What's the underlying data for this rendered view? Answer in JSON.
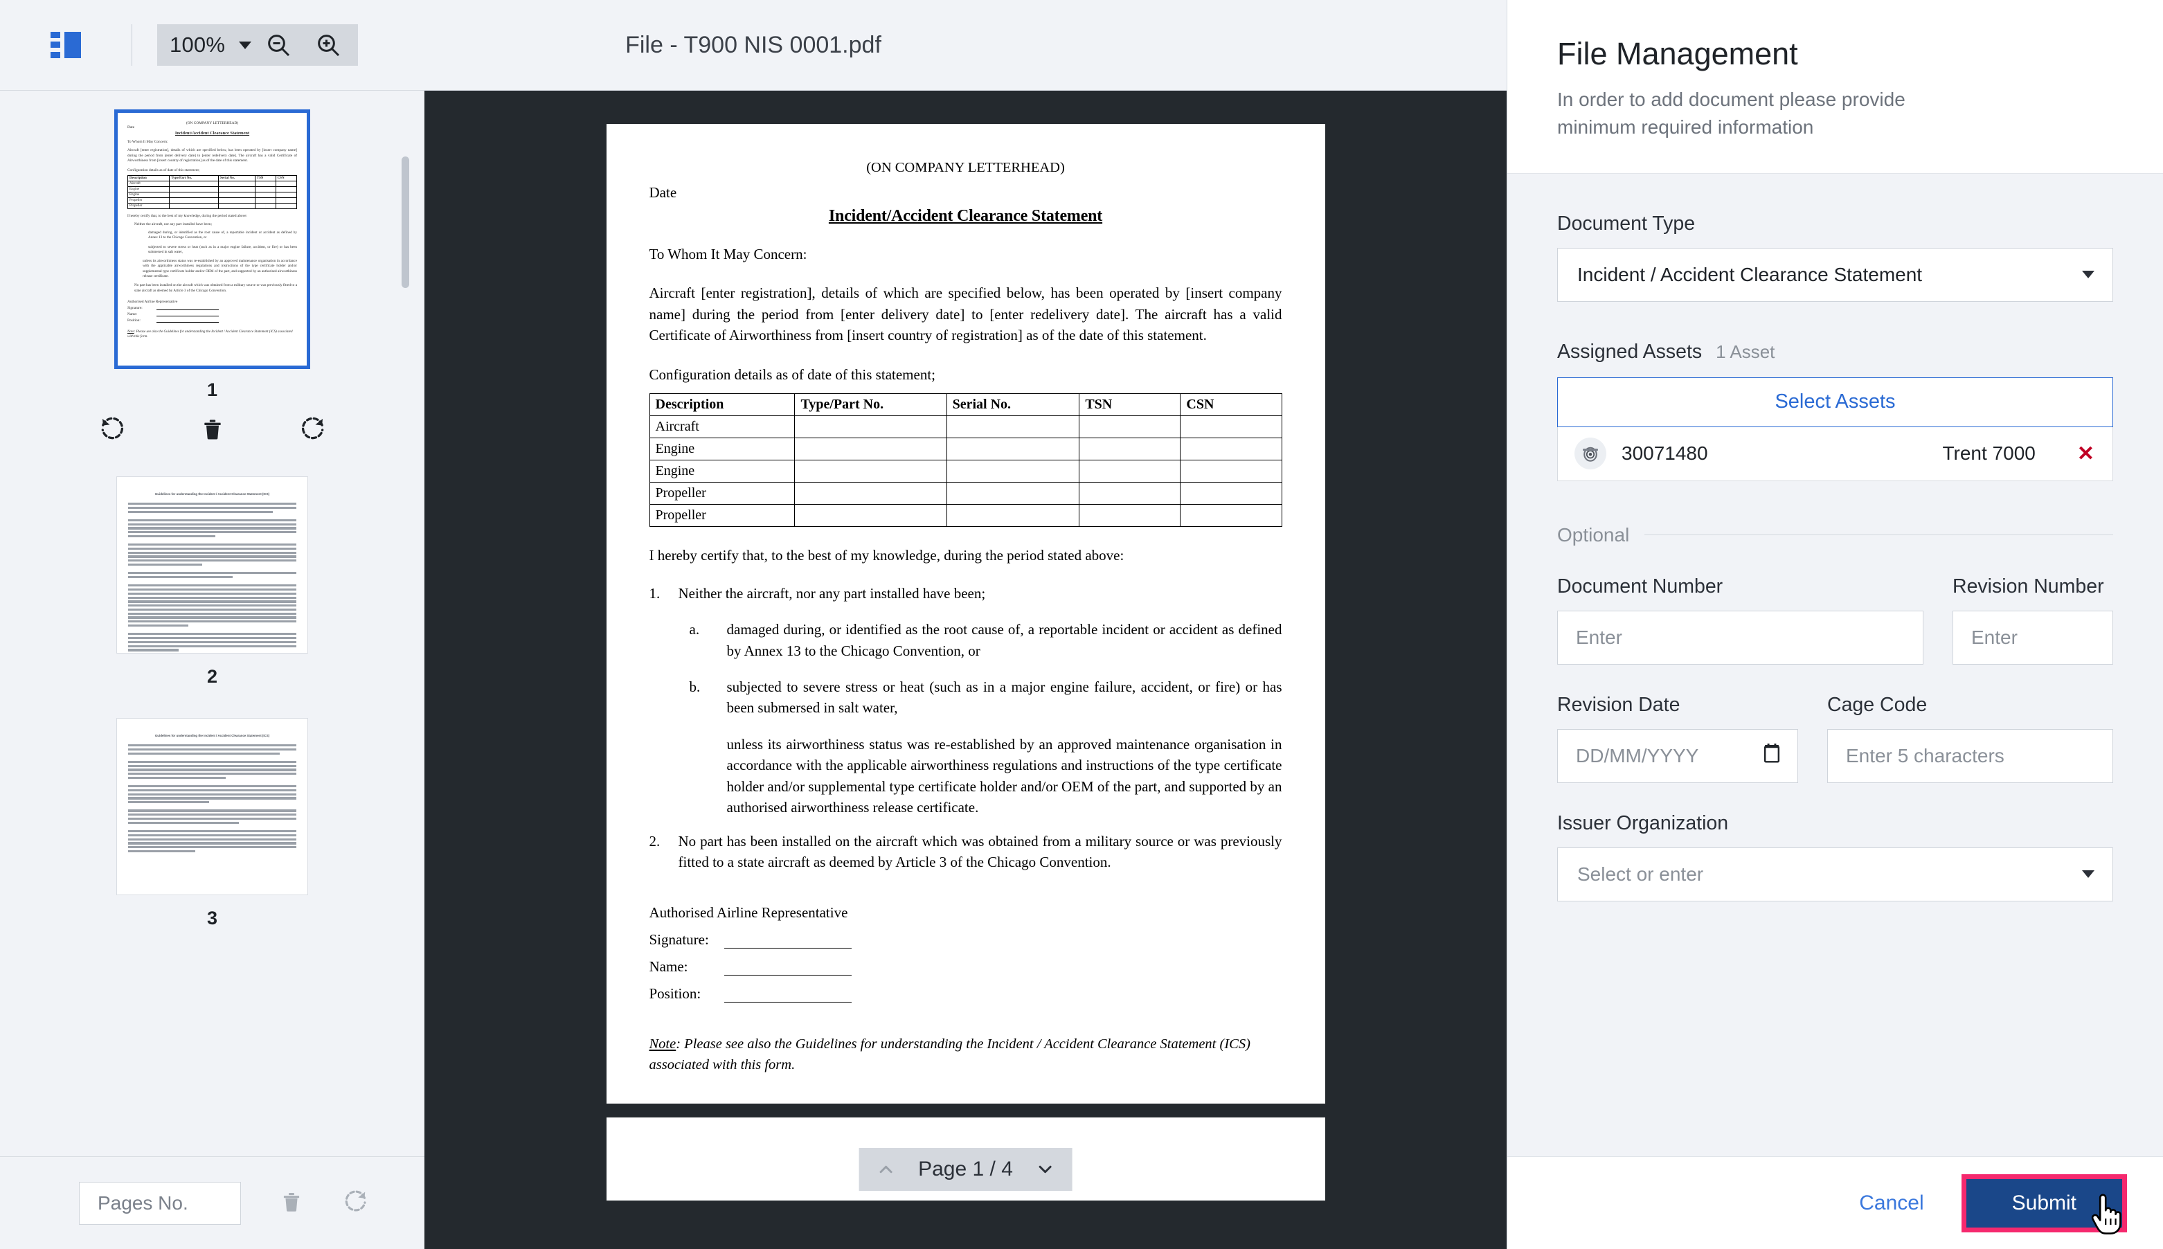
{
  "toolbar": {
    "logo_icon": "app-logo-icon",
    "zoom_value": "100%",
    "zoom_out_icon": "zoom-out-icon",
    "zoom_in_icon": "zoom-in-icon",
    "document_title": "File - T900 NIS 0001.pdf"
  },
  "thumbnails": {
    "items": [
      {
        "number": "1",
        "selected": true
      },
      {
        "number": "2",
        "selected": false
      },
      {
        "number": "3",
        "selected": false
      }
    ],
    "page_actions": {
      "rotate_left_icon": "rotate-left-icon",
      "delete_icon": "trash-icon",
      "rotate_right_icon": "rotate-right-icon"
    },
    "footer": {
      "pages_no_placeholder": "Pages No.",
      "delete_icon": "trash-icon",
      "rotate_icon": "rotate-right-icon"
    }
  },
  "page_nav": {
    "prev_icon": "chevron-up-icon",
    "label": "Page 1 / 4",
    "next_icon": "chevron-down-icon",
    "current_page": 1,
    "total_pages": 4
  },
  "document": {
    "letterhead": "(ON COMPANY LETTERHEAD)",
    "date_label": "Date",
    "title": "Incident/Accident Clearance Statement",
    "salutation": "To Whom It May Concern:",
    "intro": "Aircraft [enter registration], details of which are specified below, has been operated by [insert company name] during the period from [enter delivery date] to [enter redelivery date]. The aircraft has a valid Certificate of Airworthiness from [insert country of registration] as of the date of this statement.",
    "config_line": "Configuration details as of date of this statement;",
    "table": {
      "headers": [
        "Description",
        "Type/Part No.",
        "Serial No.",
        "TSN",
        "CSN"
      ],
      "rows": [
        [
          "Aircraft",
          "",
          "",
          "",
          ""
        ],
        [
          "Engine",
          "",
          "",
          "",
          ""
        ],
        [
          "Engine",
          "",
          "",
          "",
          ""
        ],
        [
          "Propeller",
          "",
          "",
          "",
          ""
        ],
        [
          "Propeller",
          "",
          "",
          "",
          ""
        ]
      ]
    },
    "certify": "I hereby certify that, to the best of my knowledge, during the period stated above:",
    "item1_num": "1.",
    "item1": "Neither the aircraft, nor any part installed have been;",
    "item1a_alpha": "a.",
    "item1a": "damaged during, or identified as the root cause of, a reportable incident or accident as defined by Annex 13 to the Chicago Convention, or",
    "item1b_alpha": "b.",
    "item1b": "subjected to severe stress or heat (such as in a major engine failure, accident, or fire) or has been submersed in salt water,",
    "unless": "unless its airworthiness status was re-established by an approved maintenance organisation in accordance with the applicable airworthiness regulations and instructions of the type certificate holder and/or supplemental type certificate holder and/or OEM of the part, and supported by an authorised airworthiness release certificate.",
    "item2_num": "2.",
    "item2": "No part has been installed on the aircraft which was obtained from a military source or was previously fitted to a state aircraft as deemed by Article 3 of the Chicago Convention.",
    "rep_heading": "Authorised Airline Representative",
    "sig_label": "Signature:",
    "name_label": "Name:",
    "position_label": "Position:",
    "note_prefix": "Note",
    "note_text": ": Please see also the Guidelines for understanding the Incident / Accident Clearance Statement (ICS) associated with this form."
  },
  "thumb_doc": {
    "guidelines_title": "Guidelines for understanding the Incident / Accident Clearance Statement (ICS)"
  },
  "side": {
    "title": "File Management",
    "subtitle": "In order to add document please provide minimum required information",
    "document_type": {
      "label": "Document Type",
      "value": "Incident / Accident Clearance Statement",
      "caret_icon": "chevron-down-icon"
    },
    "assigned_assets": {
      "label": "Assigned Assets",
      "count": "1 Asset",
      "select_button": "Select Assets",
      "rows": [
        {
          "icon": "engine-icon",
          "id": "30071480",
          "model": "Trent 7000",
          "remove_icon": "close-icon"
        }
      ]
    },
    "optional_label": "Optional",
    "fields": {
      "document_number": {
        "label": "Document Number",
        "placeholder": "Enter",
        "value": ""
      },
      "revision_number": {
        "label": "Revision Number",
        "placeholder": "Enter",
        "value": ""
      },
      "revision_date": {
        "label": "Revision Date",
        "placeholder": "DD/MM/YYYY",
        "value": "",
        "icon": "calendar-icon"
      },
      "cage_code": {
        "label": "Cage Code",
        "placeholder": "Enter 5 characters",
        "value": ""
      },
      "issuer_organization": {
        "label": "Issuer Organization",
        "placeholder": "Select or enter",
        "value": "",
        "caret_icon": "chevron-down-icon"
      }
    },
    "footer": {
      "cancel_label": "Cancel",
      "submit_label": "Submit",
      "highlight_color": "#f5296e",
      "submit_color": "#1a4789"
    }
  }
}
